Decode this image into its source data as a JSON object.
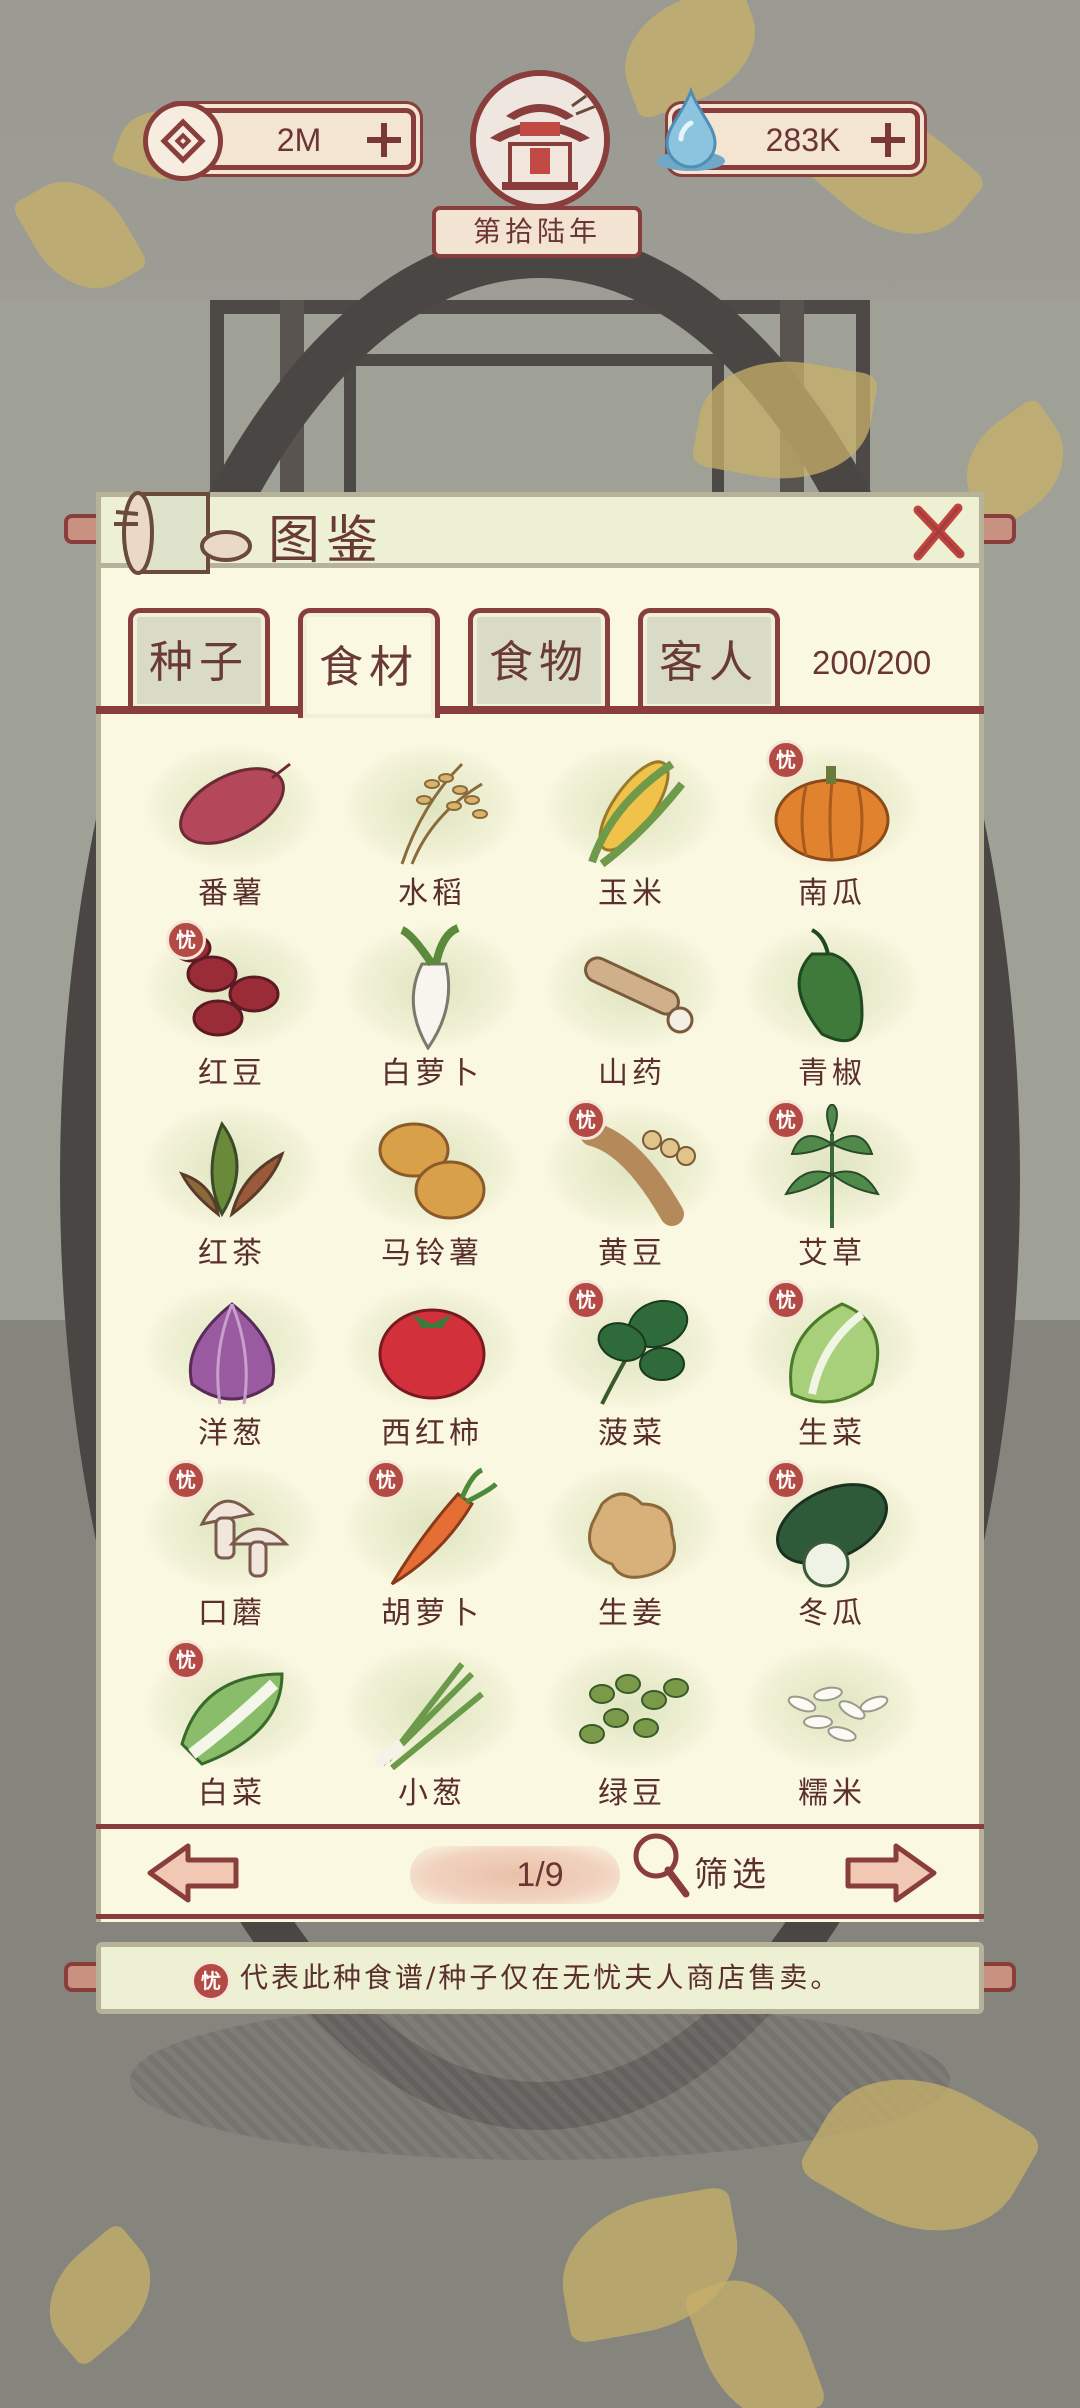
{
  "hud": {
    "coins": "2M",
    "water": "283K",
    "year": "第拾陆年"
  },
  "panel": {
    "title": "图鉴",
    "tabs": [
      {
        "label": "种子",
        "active": false
      },
      {
        "label": "食材",
        "active": true
      },
      {
        "label": "食物",
        "active": false
      },
      {
        "label": "客人",
        "active": false
      }
    ],
    "count": "200/200"
  },
  "items": [
    {
      "name": "番薯",
      "shop_only": false,
      "icon": "sweet-potato-icon"
    },
    {
      "name": "水稻",
      "shop_only": false,
      "icon": "rice-plant-icon"
    },
    {
      "name": "玉米",
      "shop_only": false,
      "icon": "corn-icon"
    },
    {
      "name": "南瓜",
      "shop_only": true,
      "icon": "pumpkin-icon"
    },
    {
      "name": "红豆",
      "shop_only": true,
      "icon": "red-bean-icon"
    },
    {
      "name": "白萝卜",
      "shop_only": false,
      "icon": "white-radish-icon"
    },
    {
      "name": "山药",
      "shop_only": false,
      "icon": "yam-icon"
    },
    {
      "name": "青椒",
      "shop_only": false,
      "icon": "green-pepper-icon"
    },
    {
      "name": "红茶",
      "shop_only": false,
      "icon": "black-tea-icon"
    },
    {
      "name": "马铃薯",
      "shop_only": false,
      "icon": "potato-icon"
    },
    {
      "name": "黄豆",
      "shop_only": true,
      "icon": "soybean-icon"
    },
    {
      "name": "艾草",
      "shop_only": true,
      "icon": "mugwort-icon"
    },
    {
      "name": "洋葱",
      "shop_only": false,
      "icon": "onion-icon"
    },
    {
      "name": "西红柿",
      "shop_only": false,
      "icon": "tomato-icon"
    },
    {
      "name": "菠菜",
      "shop_only": true,
      "icon": "spinach-icon"
    },
    {
      "name": "生菜",
      "shop_only": true,
      "icon": "lettuce-icon"
    },
    {
      "name": "口蘑",
      "shop_only": true,
      "icon": "mushroom-icon"
    },
    {
      "name": "胡萝卜",
      "shop_only": true,
      "icon": "carrot-icon"
    },
    {
      "name": "生姜",
      "shop_only": false,
      "icon": "ginger-icon"
    },
    {
      "name": "冬瓜",
      "shop_only": true,
      "icon": "winter-melon-icon"
    },
    {
      "name": "白菜",
      "shop_only": true,
      "icon": "napa-cabbage-icon"
    },
    {
      "name": "小葱",
      "shop_only": false,
      "icon": "scallion-icon"
    },
    {
      "name": "绿豆",
      "shop_only": false,
      "icon": "mung-bean-icon"
    },
    {
      "name": "糯米",
      "shop_only": false,
      "icon": "glutinous-rice-icon"
    }
  ],
  "shop_mark_char": "忧",
  "pager": {
    "page": "1/9",
    "filter_label": "筛选"
  },
  "note": "代表此种食谱/种子仅在无忧夫人商店售卖。",
  "colors": {
    "frame": "#8a3e3c",
    "paper": "#fbf8e2",
    "shop_badge": "#b34a44",
    "text": "#5a2f2c"
  }
}
